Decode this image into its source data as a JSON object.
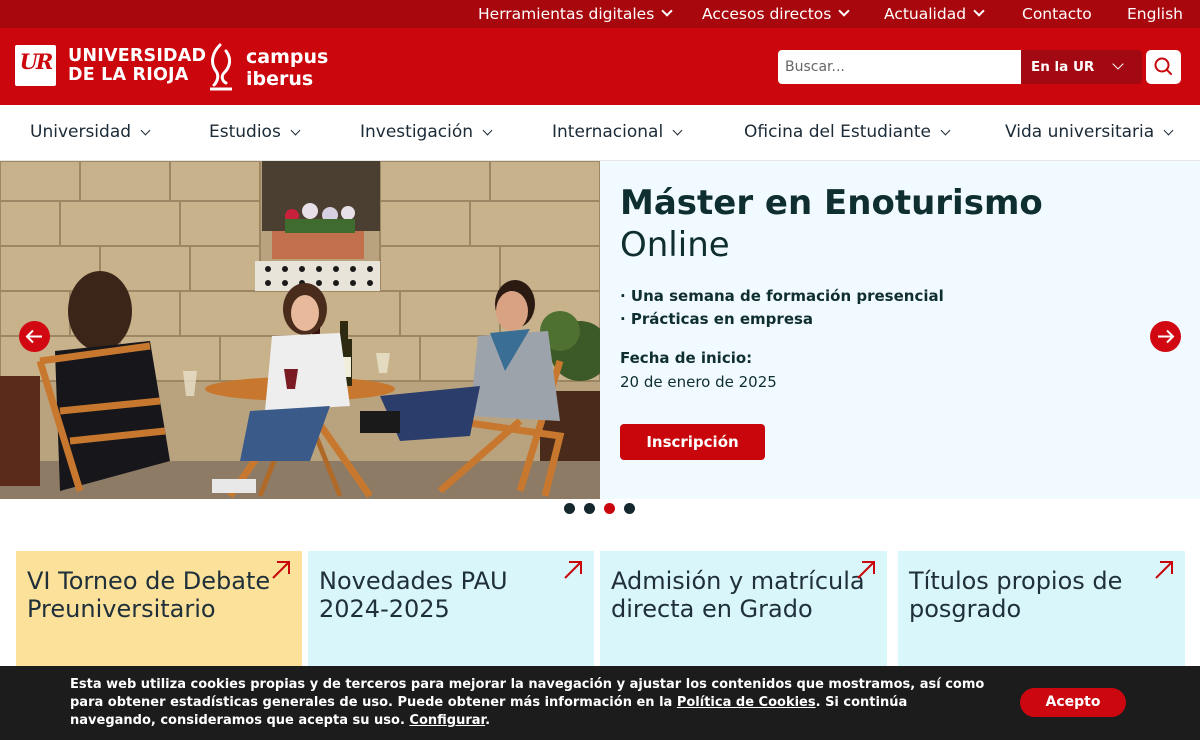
{
  "topbar": {
    "items": [
      {
        "label": "Herramientas digitales",
        "has_menu": true
      },
      {
        "label": "Accesos directos",
        "has_menu": true
      },
      {
        "label": "Actualidad",
        "has_menu": true
      },
      {
        "label": "Contacto",
        "has_menu": false
      },
      {
        "label": "English",
        "has_menu": false
      }
    ]
  },
  "header": {
    "logo_text": "UNIVERSIDAD DE LA RIOJA",
    "campus_text": "campus iberus",
    "search": {
      "placeholder": "Buscar...",
      "value": "",
      "scope_label": "En la UR"
    },
    "search_icon": "search-icon"
  },
  "nav": {
    "items": [
      {
        "label": "Universidad"
      },
      {
        "label": "Estudios"
      },
      {
        "label": "Investigación"
      },
      {
        "label": "Internacional"
      },
      {
        "label": "Oficina del Estudiante"
      },
      {
        "label": "Vida universitaria"
      }
    ]
  },
  "hero": {
    "title": "Máster en Enoturismo",
    "subtitle": "Online",
    "bullets": [
      "· Una semana de formación presencial",
      "· Prácticas en empresa"
    ],
    "date_label": "Fecha de inicio:",
    "date": "20 de enero de 2025",
    "button_label": "Inscripción",
    "prev_icon": "arrow-left-icon",
    "next_icon": "arrow-right-icon",
    "slide_count": 4,
    "active_slide": 3
  },
  "cards": [
    {
      "title": "VI Torneo de Debate Preuniversitario",
      "color": "#fce19a"
    },
    {
      "title": "Novedades PAU 2024-2025",
      "color": "#d9f6fb"
    },
    {
      "title": "Admisión y matrícula directa en Grado",
      "color": "#d9f6fb"
    },
    {
      "title": "Títulos propios de posgrado",
      "color": "#d9f6fb"
    }
  ],
  "cookie": {
    "text_1": "Esta web utiliza cookies propias y de terceros para mejorar la navegación y ajustar los contenidos que mostramos, así como para obtener estadísticas generales de uso. Puede obtener más información en la ",
    "policy_link": "Política de Cookies",
    "text_2": ". Si continúa navegando, consideramos que acepta su uso. ",
    "config_link": "Configurar",
    "text_3": ".",
    "accept_label": "Acepto"
  },
  "colors": {
    "brand_red": "#cb060c",
    "topbar_red": "#a8070d",
    "hero_bg": "#f1fbff",
    "text_dark": "#0f2e2f"
  }
}
